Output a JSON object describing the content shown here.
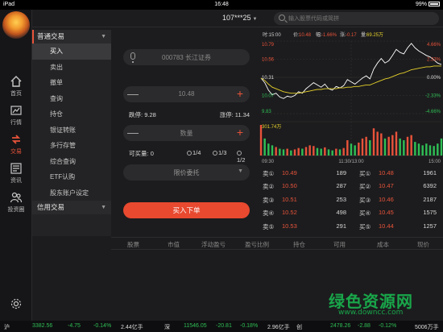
{
  "status_bar": {
    "device": "iPad",
    "time": "16:48",
    "battery": "99%"
  },
  "header": {
    "account": "107***25",
    "search_placeholder": "输入股票代码或简拼"
  },
  "rail": [
    {
      "label": "首页",
      "icon": "home-icon"
    },
    {
      "label": "行情",
      "icon": "market-icon"
    },
    {
      "label": "交易",
      "icon": "trade-icon",
      "active": true
    },
    {
      "label": "资讯",
      "icon": "news-icon"
    },
    {
      "label": "投资圈",
      "icon": "community-icon"
    }
  ],
  "menu": {
    "group1": "普通交易",
    "items": [
      "买入",
      "卖出",
      "撤单",
      "查询",
      "持仓",
      "银证转账",
      "多行存管",
      "综合查询",
      "ETF认购",
      "股东账户设定"
    ],
    "group2": "信用交易"
  },
  "form": {
    "stock": "000783 长江证券",
    "price": "10.48",
    "limit_down_label": "跌停:",
    "limit_down": "9.28",
    "limit_up_label": "涨停:",
    "limit_up": "11.34",
    "qty_placeholder": "数量",
    "buyable_label": "可买量:",
    "buyable": "0",
    "ratios": [
      "1/4",
      "1/3",
      "1/2"
    ],
    "order_type": "限价委托",
    "submit": "买入下单"
  },
  "chart_data": {
    "type": "line",
    "header": {
      "time": "时:15:00",
      "price_label": "价:",
      "price": "10.48",
      "pct_label": "幅:",
      "pct": "-1.66%",
      "chg_label": "涨:",
      "chg": "-0.17",
      "vol_label": "量:",
      "vol": "69.25万"
    },
    "y_labels_left": [
      "10.79",
      "10.56",
      "10.31",
      "10.07",
      "9.83"
    ],
    "y_labels_right": [
      "4.66%",
      "2.33%",
      "0.00%",
      "-2.33%",
      "-4.66%"
    ],
    "volume_label": "301.74万",
    "x_labels": [
      "09:30",
      "11:30/13:00",
      "15:00"
    ],
    "price_series": [
      10.3,
      10.24,
      10.14,
      10.08,
      10.1,
      10.05,
      10.03,
      10.06,
      10.05,
      10.07,
      10.12,
      10.1,
      10.16,
      10.2,
      10.24,
      10.21,
      10.18,
      10.22,
      10.16,
      10.14,
      10.19,
      10.17,
      10.2,
      10.28,
      10.25,
      10.22,
      10.26,
      10.3,
      10.33,
      10.29,
      10.42,
      10.5,
      10.56,
      10.5,
      10.53,
      10.6,
      10.68,
      10.64,
      10.62,
      10.7,
      10.76,
      10.7,
      10.66,
      10.63,
      10.6,
      10.58,
      10.54,
      10.5,
      10.48
    ],
    "avg_series": [
      10.3,
      10.27,
      10.22,
      10.18,
      10.16,
      10.14,
      10.12,
      10.11,
      10.1,
      10.1,
      10.1,
      10.11,
      10.12,
      10.13,
      10.14,
      10.15,
      10.15,
      10.16,
      10.16,
      10.16,
      10.16,
      10.17,
      10.17,
      10.18,
      10.18,
      10.19,
      10.19,
      10.2,
      10.21,
      10.21,
      10.23,
      10.25,
      10.27,
      10.29,
      10.3,
      10.32,
      10.34,
      10.36,
      10.37,
      10.39,
      10.41,
      10.42,
      10.43,
      10.44,
      10.45,
      10.45,
      10.46,
      10.46,
      10.46
    ],
    "volume_series": [
      0.9,
      0.5,
      0.35,
      0.3,
      0.25,
      0.2,
      0.18,
      0.2,
      0.15,
      0.18,
      0.22,
      0.2,
      0.25,
      0.3,
      0.28,
      0.22,
      0.2,
      0.24,
      0.18,
      0.15,
      0.2,
      0.18,
      0.22,
      0.45,
      0.35,
      0.3,
      0.38,
      0.5,
      0.55,
      0.45,
      0.8,
      0.7,
      0.65,
      0.5,
      0.55,
      0.6,
      0.7,
      0.5,
      0.45,
      0.55,
      0.6,
      0.4,
      0.35,
      0.3,
      0.35,
      0.3,
      0.28,
      0.35,
      0.5
    ],
    "y_range": [
      9.83,
      10.79
    ],
    "colors": {
      "price": "#ffffff",
      "avg": "#e6d12a",
      "volume_up": "#e8533a",
      "volume_down": "#2fbf55"
    }
  },
  "order_book": {
    "sell": [
      {
        "label": "卖⑤",
        "price": "10.53",
        "vol": "291"
      },
      {
        "label": "卖④",
        "price": "10.52",
        "vol": "498"
      },
      {
        "label": "卖③",
        "price": "10.51",
        "vol": "253"
      },
      {
        "label": "卖②",
        "price": "10.50",
        "vol": "287"
      },
      {
        "label": "卖①",
        "price": "10.49",
        "vol": "189"
      }
    ],
    "buy": [
      {
        "label": "买①",
        "price": "10.48",
        "vol": "1961"
      },
      {
        "label": "买②",
        "price": "10.47",
        "vol": "6392"
      },
      {
        "label": "买③",
        "price": "10.46",
        "vol": "2187"
      },
      {
        "label": "买④",
        "price": "10.45",
        "vol": "1575"
      },
      {
        "label": "买⑤",
        "price": "10.44",
        "vol": "1257"
      }
    ]
  },
  "positions": {
    "columns": [
      "股票",
      "市值",
      "浮动盈亏",
      "盈亏比例",
      "持仓",
      "可用",
      "成本",
      "现价"
    ]
  },
  "ticker": {
    "sh_label": "沪",
    "sh_index": "3382.56",
    "sh_chg": "-4.75",
    "sh_pct": "-0.14%",
    "sh_amount": "2.44亿手",
    "sz_label": "深",
    "sz_index": "11546.05",
    "sz_chg": "-20.81",
    "sz_pct": "-0.18%",
    "sz_amount": "2.96亿手",
    "cy_label": "创",
    "cy_index": "2478.26",
    "cy_chg": "-2.88",
    "cy_pct": "-0.12%",
    "cy_amount": "5006万手"
  },
  "watermark": {
    "line1": "绿色资源网",
    "line2": "www.downcc.com"
  }
}
